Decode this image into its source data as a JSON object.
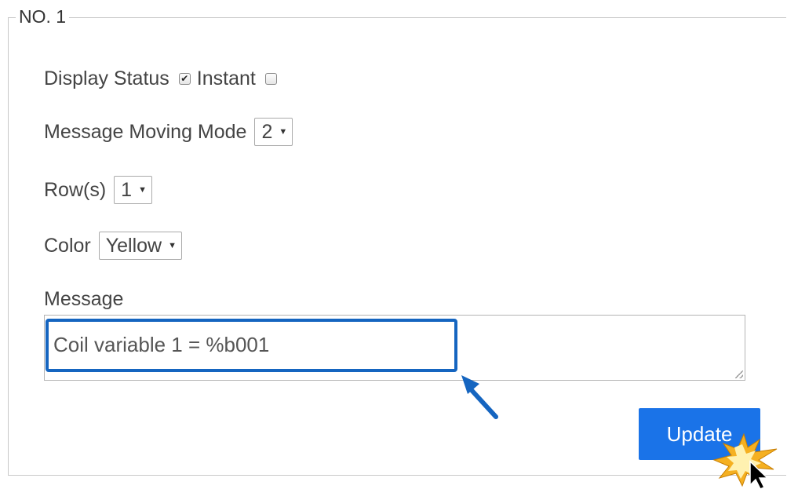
{
  "group": {
    "legend": "NO. 1"
  },
  "display_status": {
    "label": "Display Status",
    "checked": true,
    "instant_label": "Instant",
    "instant_checked": false
  },
  "moving_mode": {
    "label": "Message Moving Mode",
    "value": "2"
  },
  "rows": {
    "label": "Row(s)",
    "value": "1"
  },
  "color": {
    "label": "Color",
    "value": "Yellow"
  },
  "message": {
    "label": "Message",
    "value": "Coil variable 1 = %b001"
  },
  "update": {
    "label": "Update"
  },
  "colors": {
    "highlight": "#1565c0",
    "button": "#1a73e8",
    "burst": "#f5b021"
  },
  "icons": {
    "arrow": "pointer-arrow-icon",
    "click": "click-burst-icon",
    "cursor": "mouse-cursor-icon"
  }
}
